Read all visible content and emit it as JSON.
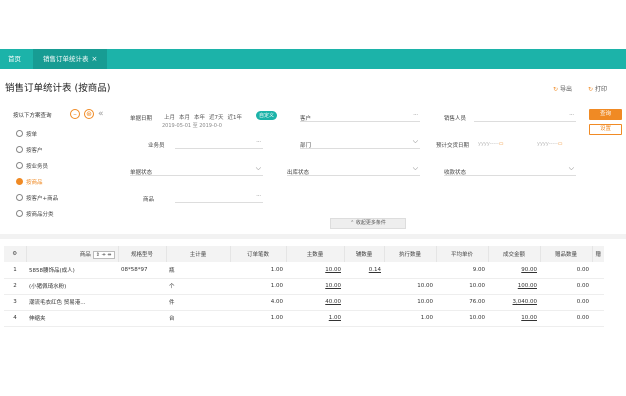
{
  "tabs": {
    "home": "首页",
    "active": "销售订单统计表",
    "close_glyph": "×"
  },
  "page": {
    "title": "销售订单统计表 (按商品)",
    "export_label": "导出",
    "print_label": "打印"
  },
  "presets": {
    "heading": "按以下方案查询",
    "add_glyph": "–",
    "more_glyph": "⊛",
    "collapse_glyph": "«",
    "items": [
      {
        "label": "按单"
      },
      {
        "label": "按客户"
      },
      {
        "label": "按业务员"
      },
      {
        "label": "按商品"
      },
      {
        "label": "按客户+商品"
      },
      {
        "label": "按商品分类"
      }
    ]
  },
  "filters": {
    "date_label": "单据日期",
    "date_options": [
      "上月",
      "本月",
      "本年",
      "近7天",
      "近1年"
    ],
    "custom_label": "自定义",
    "date_range": "2019-05-01 至 2019-0-0",
    "customer_label": "客户",
    "salesperson_label": "销售人员",
    "agent_label": "业务员",
    "dept_label": "部门",
    "delivery_label": "预计交货日期",
    "range_placeholder": "yyyy-----",
    "status_label": "单据状态",
    "outbound_label": "出库状态",
    "receipt_label": "收款状态",
    "product_label": "商品",
    "dots": "···",
    "arrow": "⌵",
    "collapse_label": "收起更多条件",
    "query_btn": "查询",
    "settings_btn": "设置"
  },
  "table": {
    "headers": [
      "",
      "商品",
      "规格型号",
      "主计量",
      "订单笔数",
      "主数量",
      "辅数量",
      "执行数量",
      "平均单价",
      "成交金额",
      "赠品数量",
      "赠"
    ],
    "sort_glyphs": "⇕ ⇸ ⇻",
    "rows": [
      {
        "idx": "1",
        "product": "5858腰饰品(成人)",
        "spec": "08*58*97",
        "unit": "瓶",
        "orders": "1.00",
        "qty": "10.00",
        "aux": "0.14",
        "exec": "",
        "price": "9.00",
        "amount": "90.00",
        "gift": "0.00"
      },
      {
        "idx": "2",
        "product": "(小猪佩琦水粉)",
        "spec": "",
        "unit": "个",
        "orders": "1.00",
        "qty": "10.00",
        "aux": "",
        "exec": "10.00",
        "price": "10.00",
        "amount": "100.00",
        "gift": "0.00"
      },
      {
        "idx": "3",
        "product": "潮流毛衣红色 贸易港...",
        "spec": "",
        "unit": "件",
        "orders": "4.00",
        "qty": "40.00",
        "aux": "",
        "exec": "10.00",
        "price": "76.00",
        "amount": "3,040.00",
        "gift": "0.00"
      },
      {
        "idx": "4",
        "product": "伸缩夹",
        "spec": "",
        "unit": "台",
        "orders": "1.00",
        "qty": "1.00",
        "aux": "",
        "exec": "1.00",
        "price": "10.00",
        "amount": "10.00",
        "gift": "0.00"
      }
    ]
  }
}
